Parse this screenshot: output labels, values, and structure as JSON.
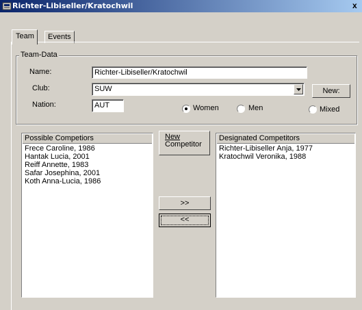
{
  "window": {
    "title": "Richter-Libiseller/Kratochwil",
    "close_glyph": "x",
    "icon": "app-icon"
  },
  "tabs": [
    {
      "label": "Team",
      "active": true
    },
    {
      "label": "Events",
      "active": false
    }
  ],
  "team_data": {
    "group_label": "Team-Data",
    "name_label": "Name:",
    "name_value": "Richter-Libiseller/Kratochwil",
    "club_label": "Club:",
    "club_value": "SUW",
    "new_label": "New:",
    "nation_label": "Nation:",
    "nation_value": "AUT",
    "gender_options": [
      {
        "label": "Women",
        "selected": true
      },
      {
        "label": "Men",
        "selected": false
      },
      {
        "label": "Mixed",
        "selected": false
      }
    ]
  },
  "possible": {
    "header": "Possible Competiors",
    "items": [
      "Frece Caroline, 1986",
      "Hantak Lucia, 2001",
      "Reiff Annette, 1983",
      "Safar Josephina, 2001",
      "Koth Anna-Lucia, 1986"
    ]
  },
  "new_competitor": {
    "line1": "New",
    "line2": "Competitor"
  },
  "move_right_label": ">>",
  "move_left_label": "<<",
  "designated": {
    "header": "Designated Competitors",
    "items": [
      "Richter-Libiseller Anja, 1977",
      "Kratochwil Veronika, 1988"
    ]
  }
}
